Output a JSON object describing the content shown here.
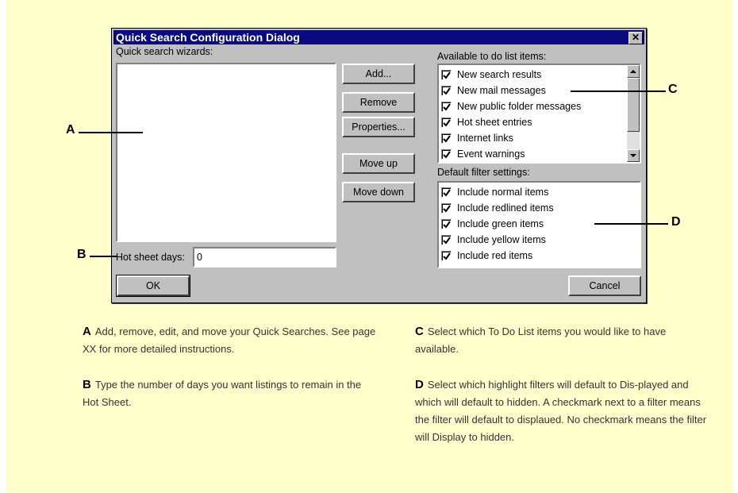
{
  "dialog": {
    "title": "Quick Search Configuration Dialog",
    "close_glyph": "✕",
    "wizards_label": "Quick search wizards:",
    "hot_sheet_label": "Hot sheet days:",
    "hot_sheet_value": "0",
    "buttons": {
      "add": "Add...",
      "remove": "Remove",
      "properties": "Properties...",
      "move_up": "Move up",
      "move_down": "Move down",
      "ok": "OK",
      "cancel": "Cancel"
    },
    "todo_label": "Available to do list items:",
    "todo_items": [
      "New search results",
      "New mail messages",
      "New public folder messages",
      "Hot sheet entries",
      "Internet links",
      "Event warnings"
    ],
    "filter_label": "Default filter settings:",
    "filter_items": [
      "Include normal items",
      "Include redlined items",
      "Include green items",
      "Include yellow items",
      "Include red items"
    ]
  },
  "callouts": {
    "a": "A",
    "b": "B",
    "c": "C",
    "d": "D"
  },
  "captions": {
    "a_key": "A",
    "a_text": "Add, remove, edit, and move your Quick Searches. See page XX for more detailed instructions.",
    "b_key": "B",
    "b_text": "Type the number of days you want listings to remain in the Hot Sheet.",
    "c_key": "C",
    "c_text": "Select which To Do List items you would like to have available.",
    "d_key": "D",
    "d_text": "Select which highlight filters will default to Dis-played and which will default to hidden. A checkmark next to a filter means the filter will default to displaued. No checkmark means the filter will Display to hidden."
  }
}
